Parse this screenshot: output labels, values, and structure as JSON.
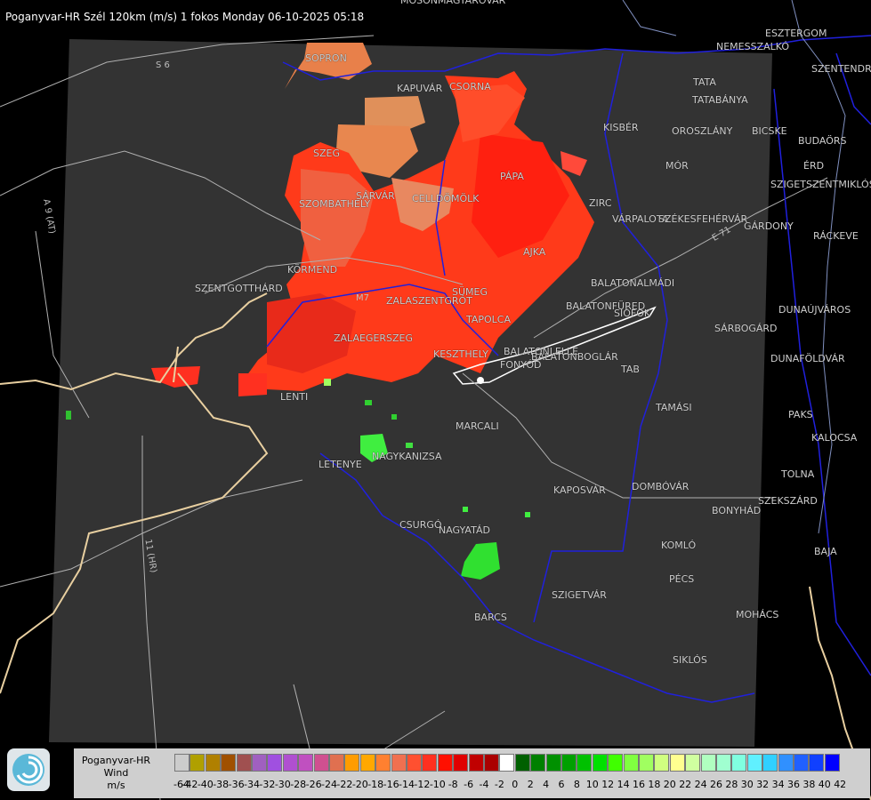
{
  "title": "Poganyvar-HR Szél 120km (m/s) 1 fokos Monday 06-10-2025 05:18",
  "cities": [
    {
      "name": "MOSONMAGYARÓVÁR",
      "id": "mosonmagyarovar"
    },
    {
      "name": "ESZTERGOM",
      "id": "esztergom"
    },
    {
      "name": "NEMESSZALKÓ",
      "id": "nemesszalko"
    },
    {
      "name": "SZENTENDRE",
      "id": "szentendre"
    },
    {
      "name": "SOPRON",
      "id": "sopron"
    },
    {
      "name": "KAPUVÁR",
      "id": "kapuvar"
    },
    {
      "name": "CSORNA",
      "id": "csorna"
    },
    {
      "name": "TATA",
      "id": "tata"
    },
    {
      "name": "TATABÁNYA",
      "id": "tatabanya"
    },
    {
      "name": "KISBÉR",
      "id": "kisber"
    },
    {
      "name": "OROSZLÁNY",
      "id": "oroszlany"
    },
    {
      "name": "BICSKE",
      "id": "bicske"
    },
    {
      "name": "BUDAÖRS",
      "id": "budaors"
    },
    {
      "name": "MÓR",
      "id": "mor"
    },
    {
      "name": "ÉRD",
      "id": "erd"
    },
    {
      "name": "SZIGETSZENTMIKLÓS",
      "id": "szigetszentmiklos"
    },
    {
      "name": "SZEG",
      "id": "szeg"
    },
    {
      "name": "PÁPA",
      "id": "papa"
    },
    {
      "name": "SÁRVÁR",
      "id": "sarvar"
    },
    {
      "name": "CELLDÖMÖLK",
      "id": "celldomolk"
    },
    {
      "name": "ZIRC",
      "id": "zirc"
    },
    {
      "name": "SZOMBATHELY",
      "id": "szombathely"
    },
    {
      "name": "VÁRPALOTA",
      "id": "varpalota"
    },
    {
      "name": "SZÉKESFEHÉRVÁR",
      "id": "szekesfehervar"
    },
    {
      "name": "GÁRDONY",
      "id": "gardony"
    },
    {
      "name": "RÁCKEVE",
      "id": "rackeve"
    },
    {
      "name": "AJKA",
      "id": "ajka"
    },
    {
      "name": "KÖRMEND",
      "id": "kormend"
    },
    {
      "name": "SZENTGOTTHÁRD",
      "id": "szentgotthard"
    },
    {
      "name": "BALATONALMÁDI",
      "id": "balatonalmadi"
    },
    {
      "name": "SÜMEG",
      "id": "sumeg"
    },
    {
      "name": "ZALASZENTGRÓT",
      "id": "zalaszentgrot"
    },
    {
      "name": "BALATONFÜRED",
      "id": "balatonfured"
    },
    {
      "name": "SIÓFOK",
      "id": "siofok"
    },
    {
      "name": "DUNAÚJVÁROS",
      "id": "dunaujvaros"
    },
    {
      "name": "TAPOLCA",
      "id": "tapolca"
    },
    {
      "name": "SÁRBOGÁRD",
      "id": "sarbogard"
    },
    {
      "name": "ZALAEGERSZEG",
      "id": "zalaegerszeg"
    },
    {
      "name": "KESZTHELY",
      "id": "keszthely"
    },
    {
      "name": "BALATONLELLE",
      "id": "balatonlelle"
    },
    {
      "name": "FONYÓD",
      "id": "fonyod"
    },
    {
      "name": "BALATONBOGLÁR",
      "id": "balatonboglar"
    },
    {
      "name": "DUNAFÖLDVÁR",
      "id": "dunafoldvar"
    },
    {
      "name": "TAB",
      "id": "tab"
    },
    {
      "name": "LENTI",
      "id": "lenti"
    },
    {
      "name": "TAMÁSI",
      "id": "tamasi"
    },
    {
      "name": "PAKS",
      "id": "paks"
    },
    {
      "name": "MARCALI",
      "id": "marcali"
    },
    {
      "name": "KALOCSA",
      "id": "kalocsa"
    },
    {
      "name": "NAGYKANIZSA",
      "id": "nagykanizsa"
    },
    {
      "name": "LETENYE",
      "id": "letenye"
    },
    {
      "name": "TOLNA",
      "id": "tolna"
    },
    {
      "name": "KAPOSVÁR",
      "id": "kaposvar"
    },
    {
      "name": "DOMBÓVÁR",
      "id": "dombovar"
    },
    {
      "name": "SZEKSZÁRD",
      "id": "szekszard"
    },
    {
      "name": "BONYHÁD",
      "id": "bonyhad"
    },
    {
      "name": "CSURGÓ",
      "id": "csurgo"
    },
    {
      "name": "NAGYATÁD",
      "id": "nagyatad"
    },
    {
      "name": "KOMLÓ",
      "id": "komlo"
    },
    {
      "name": "BAJA",
      "id": "baja"
    },
    {
      "name": "PÉCS",
      "id": "pecs"
    },
    {
      "name": "SZIGETVÁR",
      "id": "szigetvar"
    },
    {
      "name": "MOHÁCS",
      "id": "mohacs"
    },
    {
      "name": "BARCS",
      "id": "barcs"
    },
    {
      "name": "SIKLÓS",
      "id": "siklos"
    }
  ],
  "roads": [
    {
      "name": "S 6",
      "id": "s6"
    },
    {
      "name": "A 9 (AT)",
      "id": "a9"
    },
    {
      "name": "11 (HR)",
      "id": "a11"
    },
    {
      "name": "M7",
      "id": "m7"
    },
    {
      "name": "E 71",
      "id": "e71"
    }
  ],
  "legend": {
    "title_line1": "Poganyvar-HR",
    "title_line2": "Wind",
    "unit": "m/s",
    "colors": [
      "#cccccc",
      "#b0a000",
      "#b08000",
      "#a05000",
      "#a05050",
      "#a060c0",
      "#a050e0",
      "#b050d0",
      "#c050c0",
      "#d05090",
      "#e07050",
      "#ff9c00",
      "#ffa800",
      "#ff8030",
      "#f07050",
      "#ff5030",
      "#ff3020",
      "#ff1000",
      "#e00000",
      "#c00000",
      "#aa0000",
      "#ffffff",
      "#006000",
      "#008000",
      "#009000",
      "#00a000",
      "#00c000",
      "#00e000",
      "#40ff00",
      "#80ff40",
      "#a0ff60",
      "#d0ff80",
      "#ffff90",
      "#d0ffa0",
      "#b0ffc0",
      "#a0ffd0",
      "#80ffe0",
      "#60f0ff",
      "#30d0ff",
      "#3090ff",
      "#2060ff",
      "#1040ff",
      "#0000ff"
    ],
    "ticks": [
      "-64",
      "-42",
      "-40",
      "-38",
      "-36",
      "-34",
      "-32",
      "-30",
      "-28",
      "-26",
      "-24",
      "-22",
      "-20",
      "-18",
      "-16",
      "-14",
      "-12",
      "-10",
      "-8",
      "-6",
      "-4",
      "-2",
      "0",
      "2",
      "4",
      "6",
      "8",
      "10",
      "12",
      "14",
      "16",
      "18",
      "20",
      "22",
      "24",
      "26",
      "28",
      "30",
      "32",
      "34",
      "36",
      "38",
      "40",
      "42"
    ]
  }
}
